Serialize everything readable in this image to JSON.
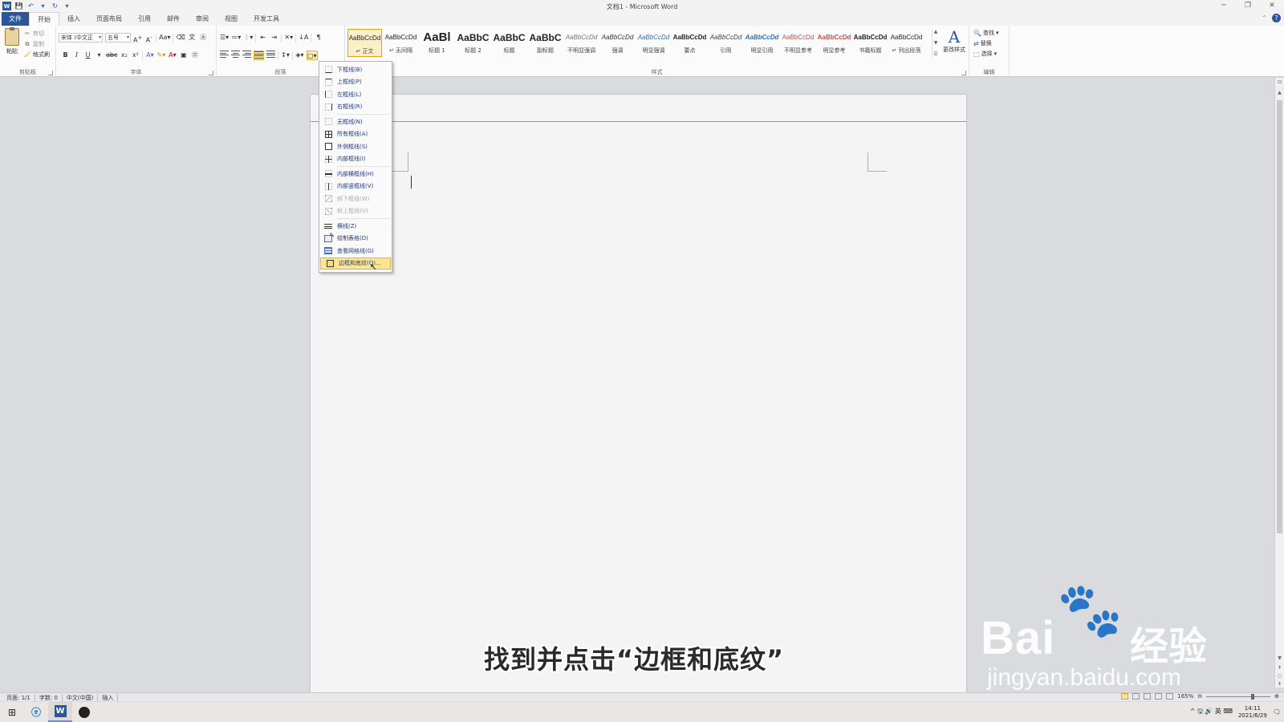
{
  "window": {
    "title": "文档1 - Microsoft Word",
    "controls": [
      "─",
      "❐",
      "✕"
    ]
  },
  "qat": [
    "W",
    "💾",
    "↶",
    "▾",
    "↻",
    "▾"
  ],
  "tabs": [
    {
      "label": "文件",
      "kind": "file"
    },
    {
      "label": "开始",
      "kind": "active"
    },
    {
      "label": "插入",
      "kind": ""
    },
    {
      "label": "页面布局",
      "kind": ""
    },
    {
      "label": "引用",
      "kind": ""
    },
    {
      "label": "邮件",
      "kind": ""
    },
    {
      "label": "审阅",
      "kind": ""
    },
    {
      "label": "视图",
      "kind": ""
    },
    {
      "label": "开发工具",
      "kind": ""
    }
  ],
  "clipboard": {
    "paste": "粘贴",
    "cut": "剪切",
    "copy": "复制",
    "format_painter": "格式刷",
    "group": "剪贴板"
  },
  "font": {
    "name": "宋体 (中文正",
    "size": "五号",
    "group": "字体"
  },
  "paragraph": {
    "group": "段落"
  },
  "styles": {
    "group": "样式",
    "tiles": [
      {
        "sample": "AaBbCcDd",
        "name": "↵ 正文",
        "color": "#222",
        "size": 8,
        "weight": "normal",
        "italic": false,
        "active": true
      },
      {
        "sample": "AaBbCcDd",
        "name": "↵ 无间隔",
        "color": "#222",
        "size": 8,
        "weight": "normal",
        "italic": false,
        "active": false
      },
      {
        "sample": "AaBl",
        "name": "标题 1",
        "color": "#222",
        "size": 15,
        "weight": "bold",
        "italic": false,
        "active": false
      },
      {
        "sample": "AaBbC",
        "name": "标题 2",
        "color": "#222",
        "size": 12,
        "weight": "bold",
        "italic": false,
        "active": false
      },
      {
        "sample": "AaBbC",
        "name": "标题",
        "color": "#222",
        "size": 12,
        "weight": "bold",
        "italic": false,
        "active": false
      },
      {
        "sample": "AaBbC",
        "name": "副标题",
        "color": "#222",
        "size": 12,
        "weight": "bold",
        "italic": false,
        "active": false
      },
      {
        "sample": "AaBbCcDd",
        "name": "不明显强调",
        "color": "#777",
        "size": 8,
        "weight": "normal",
        "italic": true,
        "active": false
      },
      {
        "sample": "AaBbCcDd",
        "name": "强调",
        "color": "#333",
        "size": 8,
        "weight": "normal",
        "italic": true,
        "active": false
      },
      {
        "sample": "AaBbCcDd",
        "name": "明显强调",
        "color": "#2f6fb5",
        "size": 8,
        "weight": "normal",
        "italic": true,
        "active": false
      },
      {
        "sample": "AaBbCcDd",
        "name": "要点",
        "color": "#222",
        "size": 8,
        "weight": "bold",
        "italic": false,
        "active": false
      },
      {
        "sample": "AaBbCcDd",
        "name": "引用",
        "color": "#444",
        "size": 8,
        "weight": "normal",
        "italic": true,
        "active": false
      },
      {
        "sample": "AaBbCcDd",
        "name": "明显引用",
        "color": "#2f6fb5",
        "size": 8,
        "weight": "bold",
        "italic": true,
        "active": false
      },
      {
        "sample": "AaBbCcDd",
        "name": "不明显参考",
        "color": "#c0504d",
        "size": 8,
        "weight": "normal",
        "italic": false,
        "active": false
      },
      {
        "sample": "AaBbCcDd",
        "name": "明显参考",
        "color": "#c0504d",
        "size": 8,
        "weight": "bold",
        "italic": false,
        "active": false
      },
      {
        "sample": "AaBbCcDd",
        "name": "书籍标题",
        "color": "#222",
        "size": 8,
        "weight": "bold",
        "italic": false,
        "active": false
      },
      {
        "sample": "AaBbCcDd",
        "name": "↵ 列出段落",
        "color": "#222",
        "size": 8,
        "weight": "normal",
        "italic": false,
        "active": false
      }
    ],
    "change_styles": "更改样式"
  },
  "editing": {
    "group": "编辑",
    "find": "查找",
    "replace": "替换",
    "select": "选择"
  },
  "border_menu": {
    "items": [
      {
        "label": "下框线(B)",
        "icon": "b-solid-bottom",
        "disabled": false,
        "sep_before": false
      },
      {
        "label": "上框线(P)",
        "icon": "b-solid-top",
        "disabled": false,
        "sep_before": false
      },
      {
        "label": "左框线(L)",
        "icon": "b-solid-left",
        "disabled": false,
        "sep_before": false
      },
      {
        "label": "右框线(R)",
        "icon": "b-solid-right",
        "disabled": false,
        "sep_before": false
      },
      {
        "label": "无框线(N)",
        "icon": "b-none",
        "disabled": false,
        "sep_before": true
      },
      {
        "label": "所有框线(A)",
        "icon": "b-all",
        "disabled": false,
        "sep_before": false
      },
      {
        "label": "外侧框线(S)",
        "icon": "b-outer",
        "disabled": false,
        "sep_before": false
      },
      {
        "label": "内部框线(I)",
        "icon": "b-inner",
        "disabled": false,
        "sep_before": false
      },
      {
        "label": "内部横框线(H)",
        "icon": "b-ih",
        "disabled": false,
        "sep_before": true
      },
      {
        "label": "内部竖框线(V)",
        "icon": "b-iv",
        "disabled": false,
        "sep_before": false
      },
      {
        "label": "斜下框线(W)",
        "icon": "b-diag",
        "disabled": true,
        "sep_before": false
      },
      {
        "label": "斜上框线(U)",
        "icon": "b-diag2",
        "disabled": true,
        "sep_before": false
      },
      {
        "label": "横线(Z)",
        "icon": "hline",
        "disabled": false,
        "sep_before": true
      },
      {
        "label": "绘制表格(D)",
        "icon": "draw",
        "disabled": false,
        "sep_before": false
      },
      {
        "label": "查看网格线(G)",
        "icon": "grid",
        "disabled": false,
        "sep_before": false
      },
      {
        "label": "边框和底纹(O)...",
        "icon": "shade",
        "disabled": false,
        "sep_before": false,
        "highlighted": true
      }
    ]
  },
  "subtitle": "找到并点击“边框和底纹”",
  "watermark": {
    "brand": "Bai",
    "brand_cn": "经验",
    "url": "jingyan.baidu.com"
  },
  "status": {
    "page": "页面: 1/1",
    "words": "字数: 0",
    "language": "中文(中国)",
    "mode": "插入",
    "zoom": "165%"
  },
  "taskbar": {
    "tray": "^ 🖫 🔊 英 ⌨",
    "time": "14:11",
    "date": "2021/6/29"
  }
}
